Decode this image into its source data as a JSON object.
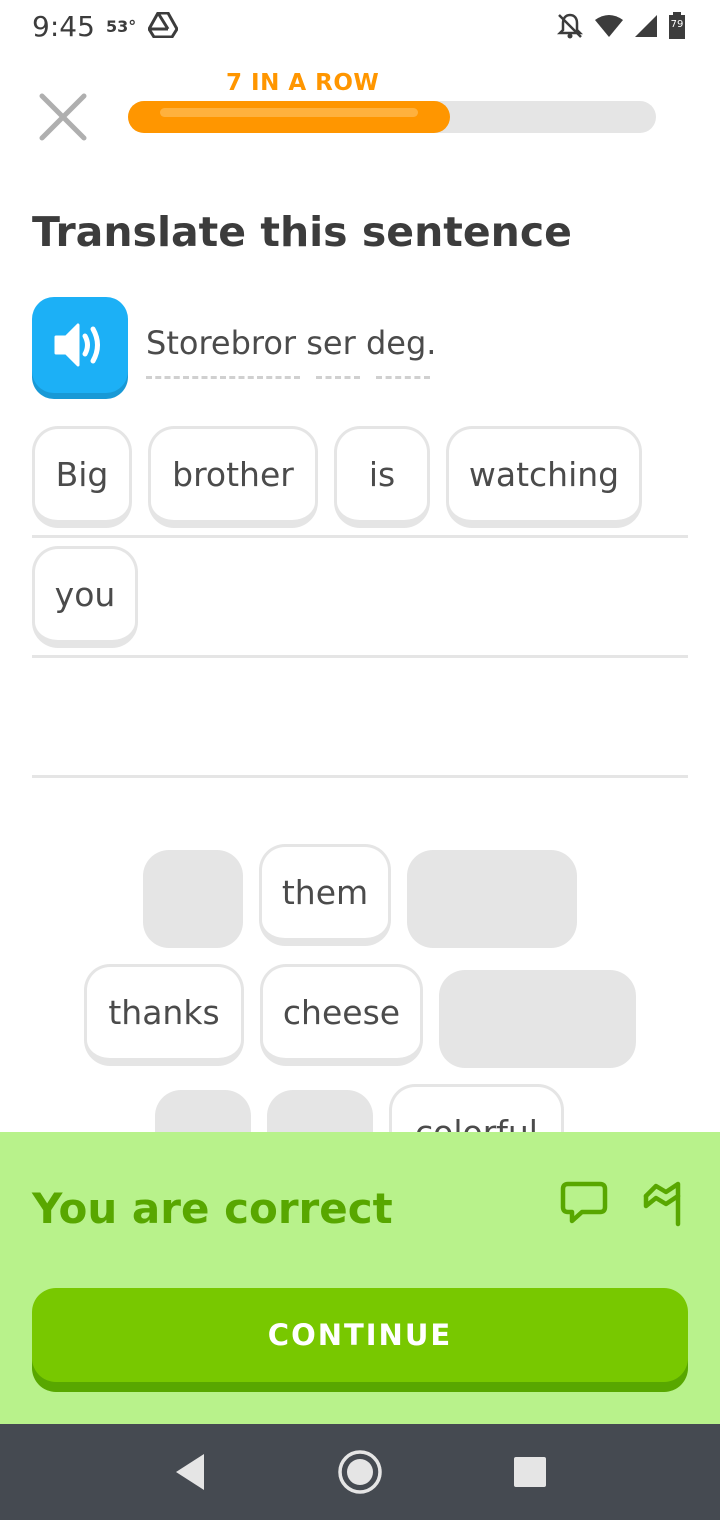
{
  "status_bar": {
    "time": "9:45",
    "temperature": "53°",
    "battery_level": "79",
    "icons": [
      "drive-icon",
      "notifications-off-icon",
      "wifi-icon",
      "signal-icon",
      "battery-icon"
    ]
  },
  "header": {
    "close_icon": "close-icon",
    "streak_label": "7 IN A ROW",
    "progress_fraction": 0.61
  },
  "exercise": {
    "title": "Translate this sentence",
    "prompt_words": [
      "Storebror",
      "ser",
      "deg."
    ],
    "prompt_text": "Storebror ser deg.",
    "speaker_icon": "speaker-icon"
  },
  "answer": {
    "words": [
      "Big",
      "brother",
      "is",
      "watching",
      "you"
    ]
  },
  "word_bank": {
    "visible_words": [
      "them",
      "thanks",
      "cheese",
      "colorful"
    ]
  },
  "feedback": {
    "message": "You are correct",
    "continue_label": "CONTINUE",
    "icons": [
      "comment-icon",
      "flag-icon"
    ]
  },
  "colors": {
    "accent_orange": "#ff9600",
    "speaker_blue": "#1cb0f6",
    "correct_bg": "#b8f28b",
    "correct_text": "#58a700",
    "continue_green": "#78c800",
    "nav_bar": "#454a51"
  }
}
